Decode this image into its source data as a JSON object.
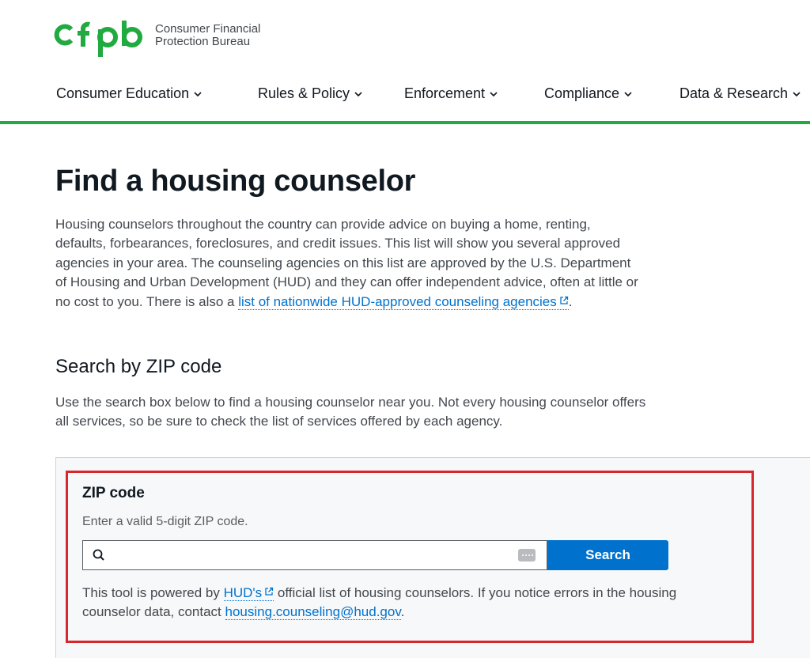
{
  "header": {
    "logo_text_line1": "Consumer Financial",
    "logo_text_line2": "Protection Bureau",
    "brand_color": "#20aa3f"
  },
  "nav": {
    "items": [
      {
        "label": "Consumer Education"
      },
      {
        "label": "Rules & Policy"
      },
      {
        "label": "Enforcement"
      },
      {
        "label": "Compliance"
      },
      {
        "label": "Data & Research"
      }
    ]
  },
  "main": {
    "title": "Find a housing counselor",
    "intro_text": "Housing counselors throughout the country can provide advice on buying a home, renting, defaults, forbearances, foreclosures, and credit issues. This list will show you several approved agencies in your area. The counseling agencies on this list are approved by the U.S. Department of Housing and Urban Development (HUD) and they can offer independent advice, often at little or no cost to you. There is also a ",
    "intro_link": "list of nationwide HUD-approved counseling agencies",
    "intro_end": ".",
    "search_heading": "Search by ZIP code",
    "search_desc": "Use the search box below to find a housing counselor near you. Not every housing counselor offers all services, so be sure to check the list of services offered by each agency."
  },
  "search": {
    "label": "ZIP code",
    "help": "Enter a valid 5-digit ZIP code.",
    "value": "",
    "placeholder": "",
    "button": "Search",
    "note_pre": "This tool is powered by ",
    "note_link": "HUD's",
    "note_mid": " official list of housing counselors. If you notice errors in the housing counselor data, contact ",
    "note_email": "housing.counseling@hud.gov",
    "note_end": "."
  },
  "colors": {
    "link": "#0072ce",
    "button": "#0072ce",
    "highlight": "#d7262e",
    "panel_bg": "#f7f8f9"
  }
}
